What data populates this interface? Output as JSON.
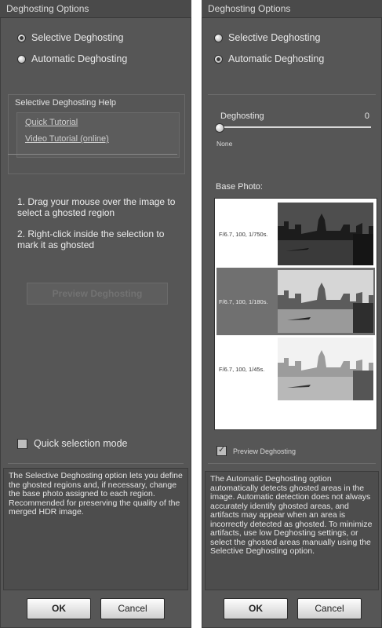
{
  "left": {
    "title": "Deghosting Options",
    "radio_selective": "Selective Deghosting",
    "radio_automatic": "Automatic Deghosting",
    "help_title": "Selective Deghosting Help",
    "link_quick": "Quick Tutorial",
    "link_video": "Video Tutorial (online)",
    "step1": "1. Drag your  mouse over the image to select a ghosted region",
    "step2": "2. Right-click inside the selection to mark it as ghosted",
    "preview_button": "Preview Deghosting",
    "quick_selection": "Quick selection mode",
    "description": "The Selective Deghosting option lets you define the ghosted regions and, if necessary, change the base photo assigned to each region. Recommended for preserving the quality of the merged HDR image.",
    "ok": "OK",
    "cancel": "Cancel"
  },
  "right": {
    "title": "Deghosting Options",
    "radio_selective": "Selective Deghosting",
    "radio_automatic": "Automatic Deghosting",
    "slider_label": "Deghosting",
    "slider_value": "0",
    "slider_min_label": "None",
    "base_photo_label": "Base Photo:",
    "photos": [
      {
        "exif": "F/6.7, 100, 1/750s."
      },
      {
        "exif": "F/6.7, 100, 1/180s."
      },
      {
        "exif": "F/6.7, 100, 1/45s."
      }
    ],
    "preview_label": "Preview Deghosting",
    "description": "The Automatic Deghosting option automatically detects ghosted areas in the image. Automatic detection does not always accurately identify ghosted areas, and artifacts may appear when an area is incorrectly detected as ghosted. To minimize artifacts, use low Deghosting settings, or select the ghosted areas manually using the Selective Deghosting option.",
    "ok": "OK",
    "cancel": "Cancel"
  }
}
